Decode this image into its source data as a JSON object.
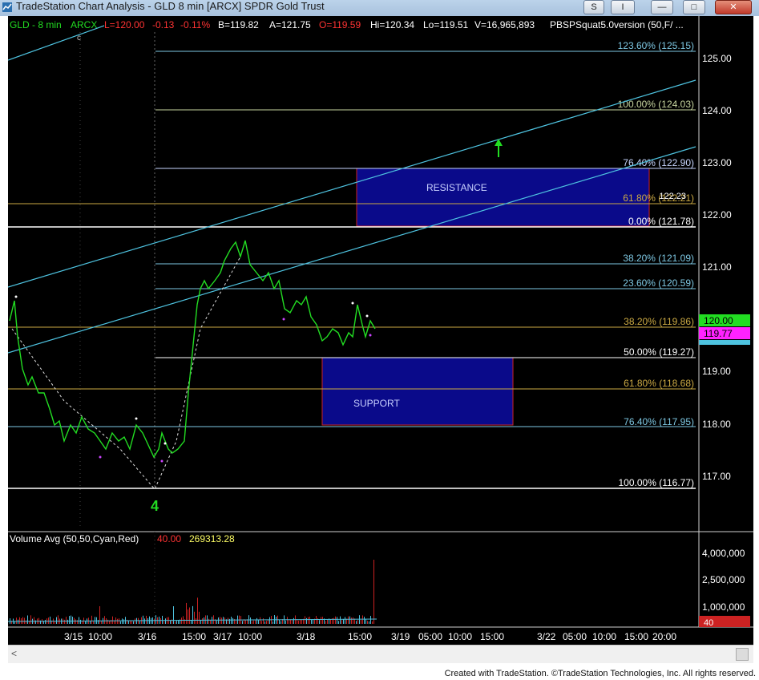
{
  "window": {
    "title": "TradeStation Chart Analysis - GLD 8 min [ARCX] SPDR Gold Trust",
    "btn_s": "S",
    "btn_i": "I",
    "btn_min": "—",
    "btn_max": "□",
    "btn_close": "✕"
  },
  "header": {
    "symbol": "GLD - 8 min",
    "exchange": "ARCX",
    "last": "L=120.00",
    "change": "-0.13",
    "pct": "-0.11%",
    "bid": "B=119.82",
    "ask": "A=121.75",
    "open": "O=119.59",
    "high": "Hi=120.34",
    "low": "Lo=119.51",
    "volume": "V=16,965,893",
    "study": "PBSPSquat5.0version (50,F/ ..."
  },
  "price_axis": [
    "125.00",
    "124.00",
    "123.00",
    "122.00",
    "121.00",
    "120.00",
    "119.00",
    "118.00",
    "117.00"
  ],
  "price_tags": {
    "green": "120.00",
    "magenta": "119.77"
  },
  "fib_levels": [
    {
      "label": "123.60% (125.15)",
      "color": "#7ec8e3"
    },
    {
      "label": "100.00% (124.03)",
      "color": "#c8d6a0"
    },
    {
      "label": "76.40% (122.90)",
      "color": "#c8d6ff"
    },
    {
      "label": "61.80% (122.21)",
      "color": "#ccaa44"
    },
    {
      "label": "0.00% (121.78)",
      "color": "#ffffff"
    },
    {
      "label": "38.20% (121.09)",
      "color": "#7ec8e3"
    },
    {
      "label": "23.60% (120.59)",
      "color": "#7ec8e3"
    },
    {
      "label": "38.20% (119.86)",
      "color": "#ccaa44"
    },
    {
      "label": "50.00% (119.27)",
      "color": "#ffffff"
    },
    {
      "label": "61.80% (118.68)",
      "color": "#ccaa44"
    },
    {
      "label": "76.40% (117.95)",
      "color": "#7ec8e3"
    },
    {
      "label": "100.00% (116.77)",
      "color": "#ffffff"
    }
  ],
  "annotations": {
    "resistance": "RESISTANCE",
    "support": "SUPPORT",
    "wave_label": "4",
    "c_label": "c",
    "price_label": "122.23"
  },
  "volume": {
    "title": "Volume Avg (50,50,Cyan,Red)",
    "val1": "40.00",
    "val2": "269313.28",
    "axis": [
      "4,000,000",
      "2,500,000",
      "1,000,000"
    ],
    "tag": "40"
  },
  "time_axis": [
    "3/15",
    "10:00",
    "3/16",
    "15:00",
    "3/17",
    "10:00",
    "3/18",
    "15:00",
    "3/19",
    "05:00",
    "10:00",
    "15:00",
    "3/22",
    "05:00",
    "10:00",
    "15:00",
    "20:00"
  ],
  "footer": "Created with TradeStation. ©TradeStation Technologies, Inc. All rights reserved.",
  "colors": {
    "price": "#22dd22",
    "box": "#0a0a8a",
    "box_border": "#cc2222",
    "channel": "#4ec3e0"
  }
}
